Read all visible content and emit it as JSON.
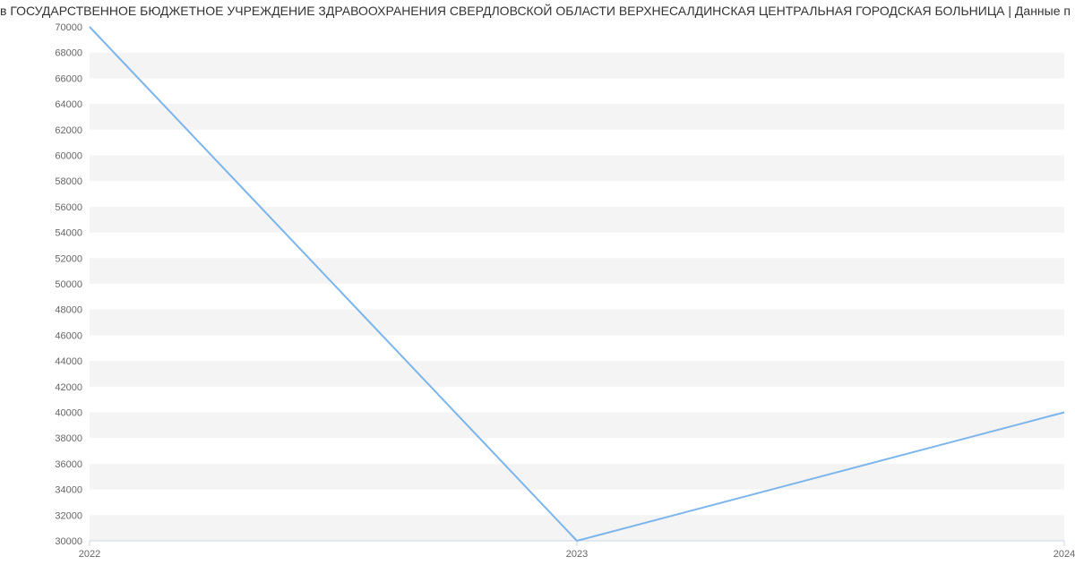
{
  "title": "в ГОСУДАРСТВЕННОЕ БЮДЖЕТНОЕ УЧРЕЖДЕНИЕ ЗДРАВООХРАНЕНИЯ СВЕРДЛОВСКОЙ ОБЛАСТИ ВЕРХНЕСАЛДИНСКАЯ ЦЕНТРАЛЬНАЯ ГОРОДСКАЯ БОЛЬНИЦА | Данные п",
  "chart_data": {
    "type": "line",
    "x": [
      2022,
      2023,
      2024
    ],
    "values": [
      70000,
      30000,
      40000
    ],
    "title": "в ГОСУДАРСТВЕННОЕ БЮДЖЕТНОЕ УЧРЕЖДЕНИЕ ЗДРАВООХРАНЕНИЯ СВЕРДЛОВСКОЙ ОБЛАСТИ ВЕРХНЕСАЛДИНСКАЯ ЦЕНТРАЛЬНАЯ ГОРОДСКАЯ БОЛЬНИЦА | Данные п",
    "xlabel": "",
    "ylabel": "",
    "ylim": [
      30000,
      70000
    ],
    "yticks": [
      30000,
      32000,
      34000,
      36000,
      38000,
      40000,
      42000,
      44000,
      46000,
      48000,
      50000,
      52000,
      54000,
      56000,
      58000,
      60000,
      62000,
      64000,
      66000,
      68000,
      70000
    ],
    "xticks": [
      2022,
      2023,
      2024
    ],
    "series_color": "#7cb5ec"
  }
}
